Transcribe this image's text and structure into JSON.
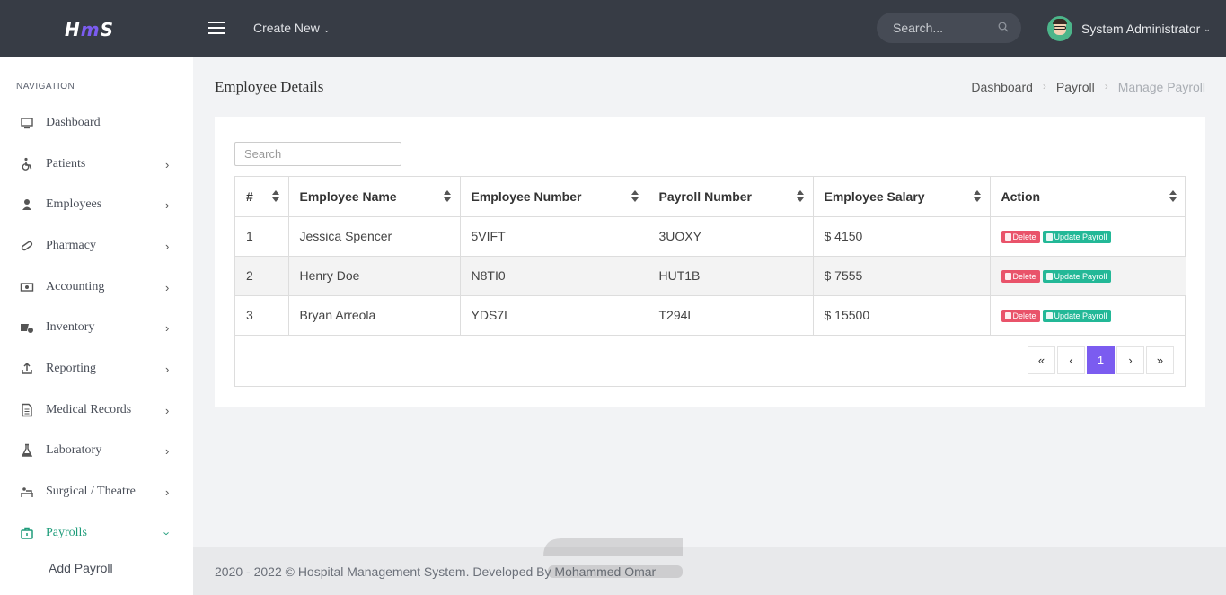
{
  "topbar": {
    "logo": {
      "h": "H",
      "m": "m",
      "s": "S"
    },
    "create_new": "Create New",
    "search_placeholder": "Search...",
    "user_name": "System Administrator"
  },
  "sidebar": {
    "title": "NAVIGATION",
    "items": [
      {
        "label": "Dashboard",
        "icon": "monitor-icon"
      },
      {
        "label": "Patients",
        "icon": "wheelchair-icon"
      },
      {
        "label": "Employees",
        "icon": "user-icon"
      },
      {
        "label": "Pharmacy",
        "icon": "pill-icon"
      },
      {
        "label": "Accounting",
        "icon": "money-icon"
      },
      {
        "label": "Inventory",
        "icon": "truck-icon"
      },
      {
        "label": "Reporting",
        "icon": "upload-icon"
      },
      {
        "label": "Medical Records",
        "icon": "file-icon"
      },
      {
        "label": "Laboratory",
        "icon": "flask-icon"
      },
      {
        "label": "Surgical / Theatre",
        "icon": "bed-icon"
      },
      {
        "label": "Payrolls",
        "icon": "briefcase-icon"
      }
    ],
    "sub_item": "Add Payroll"
  },
  "page": {
    "title": "Employee Details",
    "breadcrumb": [
      "Dashboard",
      "Payroll",
      "Manage Payroll"
    ]
  },
  "table": {
    "search_placeholder": "Search",
    "columns": [
      "#",
      "Employee Name",
      "Employee Number",
      "Payroll Number",
      "Employee Salary",
      "Action"
    ],
    "rows": [
      [
        "1",
        "Jessica Spencer",
        "5VIFT",
        "3UOXY",
        "$ 4150"
      ],
      [
        "2",
        "Henry Doe",
        "N8TI0",
        "HUT1B",
        "$ 7555"
      ],
      [
        "3",
        "Bryan Arreola",
        "YDS7L",
        "T294L",
        "$ 15500"
      ]
    ],
    "delete_label": "Delete",
    "update_label": "Update Payroll",
    "pager": {
      "first": "«",
      "prev": "‹",
      "current": "1",
      "next": "›",
      "last": "»"
    }
  },
  "footer": "2020 - 2022 © Hospital Management System. Developed By Mohammed Omar",
  "colors": {
    "accent": "#7b5cf0",
    "active": "#1e9c7a",
    "delete": "#e9536a",
    "update": "#23b897",
    "topbar": "#373c45"
  }
}
